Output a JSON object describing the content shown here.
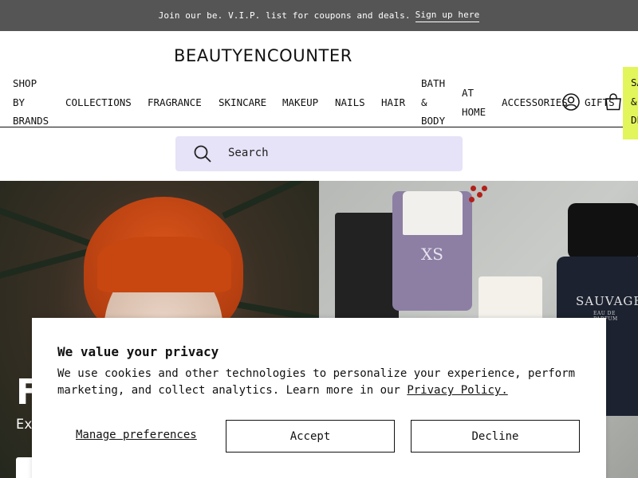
{
  "promo": {
    "text": "Join our be. V.I.P. list for coupons and deals.",
    "link": "Sign up here",
    "bg_color": "#555555"
  },
  "header": {
    "logo": "BEAUTYENCOUNTER"
  },
  "nav": {
    "items": [
      "SHOP\nBY\nBRANDS",
      "COLLECTIONS",
      "FRAGRANCE",
      "SKINCARE",
      "MAKEUP",
      "NAILS",
      "HAIR",
      "BATH\n&\nBODY",
      "AT\nHOME",
      "ACCESSORIES",
      "GIFTS",
      "SA\n&\nDE"
    ],
    "sale_bg_color": "#e2f55a",
    "icons": [
      "account-icon",
      "shopping-bag-icon"
    ]
  },
  "search": {
    "placeholder": "Search",
    "bg_color": "#e6e2f7",
    "icon": "search-icon"
  },
  "hero": {
    "headline": "F",
    "subtext": "Ex",
    "product_label_xs": "XS",
    "product_label_sauvage": "SAUVAGE",
    "product_sub_sauvage": "EAU DE PARFUM"
  },
  "cookie_banner": {
    "title": "We value your privacy",
    "body": "We use cookies and other technologies to personalize your experience, perform marketing, and collect analytics. Learn more in our",
    "policy_link": "Privacy Policy.",
    "manage_label": "Manage preferences",
    "accept_label": "Accept",
    "decline_label": "Decline"
  }
}
